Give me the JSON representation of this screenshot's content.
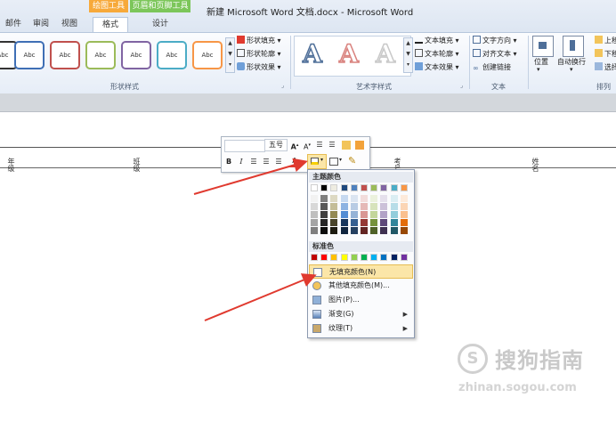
{
  "window": {
    "title": "新建 Microsoft Word 文档.docx - Microsoft Word",
    "context_groups": [
      "绘图工具",
      "页眉和页脚工具"
    ]
  },
  "tabs": [
    "邮件",
    "审阅",
    "视图",
    "格式",
    "设计"
  ],
  "ribbon": {
    "shape_styles_label": "形状样式",
    "abc_label": "Abc",
    "shape_commands": [
      "形状填充",
      "形状轮廓",
      "形状效果"
    ],
    "wordart_label": "艺术字样式",
    "wordart_letter": "A",
    "text_commands": [
      "文本填充",
      "文本轮廓",
      "文本效果"
    ],
    "text_group": {
      "items": [
        "文字方向",
        "对齐文本",
        "创建链接"
      ],
      "label": "文本"
    },
    "position_label": "位置",
    "wrap_label": "自动换行",
    "arrange": {
      "items": [
        "上移",
        "下移",
        "选择"
      ],
      "label": "排列"
    }
  },
  "page": {
    "side_labels": [
      "年级",
      "班级",
      "考号",
      "姓名"
    ]
  },
  "mini_toolbar": {
    "font_size": "五号",
    "bold": "B",
    "italic": "I",
    "font_color": "A"
  },
  "color_menu": {
    "theme_header": "主题颜色",
    "standard_header": "标准色",
    "theme_top": [
      "#ffffff",
      "#000000",
      "#eeece1",
      "#1f497d",
      "#4f81bd",
      "#c0504d",
      "#9bbb59",
      "#8064a2",
      "#4bacc6",
      "#f79646"
    ],
    "theme_shades": [
      [
        "#f2f2f2",
        "#7f7f7f",
        "#ddd9c3",
        "#c6d9f0",
        "#dbe5f1",
        "#f2dcdb",
        "#ebf1dd",
        "#e5e0ec",
        "#dbeef3",
        "#fdeada"
      ],
      [
        "#d8d8d8",
        "#595959",
        "#c4bd97",
        "#8db3e2",
        "#b8cce4",
        "#e5b9b7",
        "#d7e3bc",
        "#ccc1d9",
        "#b7dde8",
        "#fbd5b5"
      ],
      [
        "#bfbfbf",
        "#3f3f3f",
        "#938953",
        "#548dd4",
        "#95b3d7",
        "#d99694",
        "#c3d69b",
        "#b2a2c7",
        "#92cddc",
        "#fac08f"
      ],
      [
        "#a5a5a5",
        "#262626",
        "#494429",
        "#17365d",
        "#366092",
        "#953734",
        "#76923c",
        "#5f497a",
        "#31859b",
        "#e36c09"
      ],
      [
        "#7f7f7f",
        "#0c0c0c",
        "#1d1b10",
        "#0f243e",
        "#244061",
        "#632423",
        "#4f6128",
        "#3f3151",
        "#205867",
        "#974806"
      ]
    ],
    "standard": [
      "#c00000",
      "#ff0000",
      "#ffc000",
      "#ffff00",
      "#92d050",
      "#00b050",
      "#00b0f0",
      "#0070c0",
      "#002060",
      "#7030a0"
    ],
    "items": [
      {
        "label": "无填充颜色(N)",
        "icon": "no-fill-icon",
        "submenu": false
      },
      {
        "label": "其他填充颜色(M)...",
        "icon": "color-palette-icon",
        "submenu": false
      },
      {
        "label": "图片(P)...",
        "icon": "picture-icon",
        "submenu": false
      },
      {
        "label": "渐变(G)",
        "icon": "gradient-icon",
        "submenu": true
      },
      {
        "label": "纹理(T)",
        "icon": "texture-icon",
        "submenu": true
      }
    ]
  },
  "watermark": {
    "brand": "搜狗指南",
    "url": "zhinan.sogou.com",
    "logo_letter": "S"
  },
  "colors": {
    "accent_orange": "#f7a93a",
    "accent_green": "#7cc65a",
    "arrow_red": "#e03a2f",
    "menu_highlight": "#fbe6a8"
  }
}
